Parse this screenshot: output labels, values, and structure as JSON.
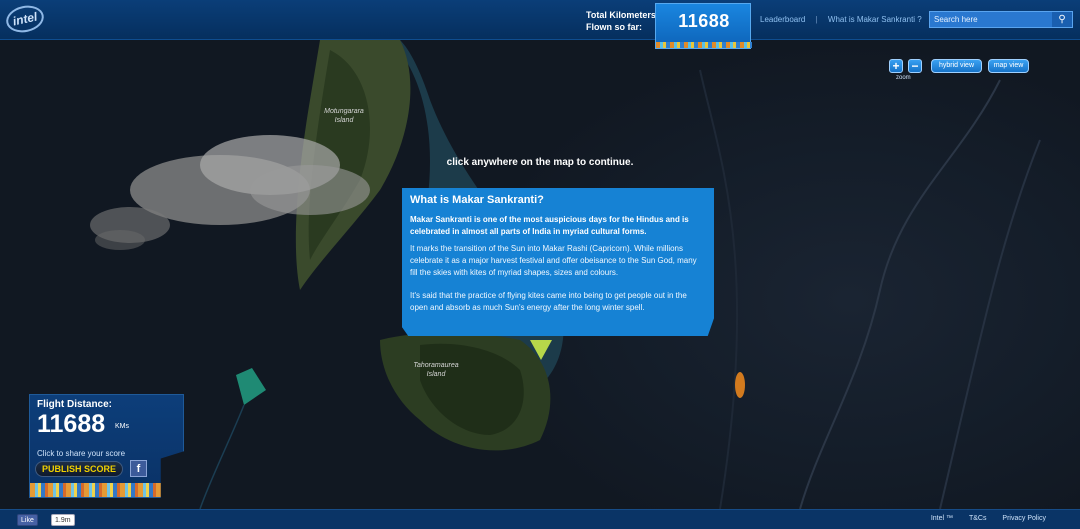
{
  "header": {
    "logo_text": "intel",
    "km_label": "Total Kilometers Flown so far:",
    "km_value": "11688",
    "nav": [
      "Leaderboard",
      "|",
      "What is Makar Sankranti ?"
    ],
    "search_placeholder": "Search here"
  },
  "map_controls": {
    "zoom_in": "+",
    "zoom_out": "−",
    "zoom_label": "zoom",
    "hybrid_view": "hybrid view",
    "map_view": "map view"
  },
  "map": {
    "continue_text": "click anywhere on the map to continue.",
    "island_labels": [
      "Motungarara Island",
      "Tahoramaurea Island"
    ]
  },
  "popup": {
    "title": "What is Makar Sankranti?",
    "lead": "Makar Sankranti is one of the most auspicious days for the Hindus and is celebrated in almost all parts of India in myriad cultural forms.",
    "paragraphs": [
      "It marks the transition of the Sun into Makar Rashi (Capricorn). While millions celebrate it as a major harvest festival and offer obeisance to the Sun God, many fill the skies with kites of myriad shapes, sizes and colours.",
      "It's said that the practice of flying kites came into being to get people out in the open and absorb as much Sun's energy after the long winter spell."
    ]
  },
  "score_panel": {
    "title": "Flight Distance:",
    "value": "11688",
    "unit": "KMs",
    "share_text": "Click to share your score",
    "publish_label": "PUBLISH SCORE",
    "facebook_label": "f"
  },
  "footer": {
    "like_label": "Like",
    "like_count": "1.9m",
    "links": [
      "Intel ™",
      "T&Cs",
      "Privacy Policy"
    ]
  },
  "colors": {
    "header_blue": "#0a3e78",
    "popup_blue": "#1682d4",
    "publish_yellow": "#f0d000",
    "kite_green": "#1f8a74",
    "kite_orange": "#d27a1e"
  }
}
